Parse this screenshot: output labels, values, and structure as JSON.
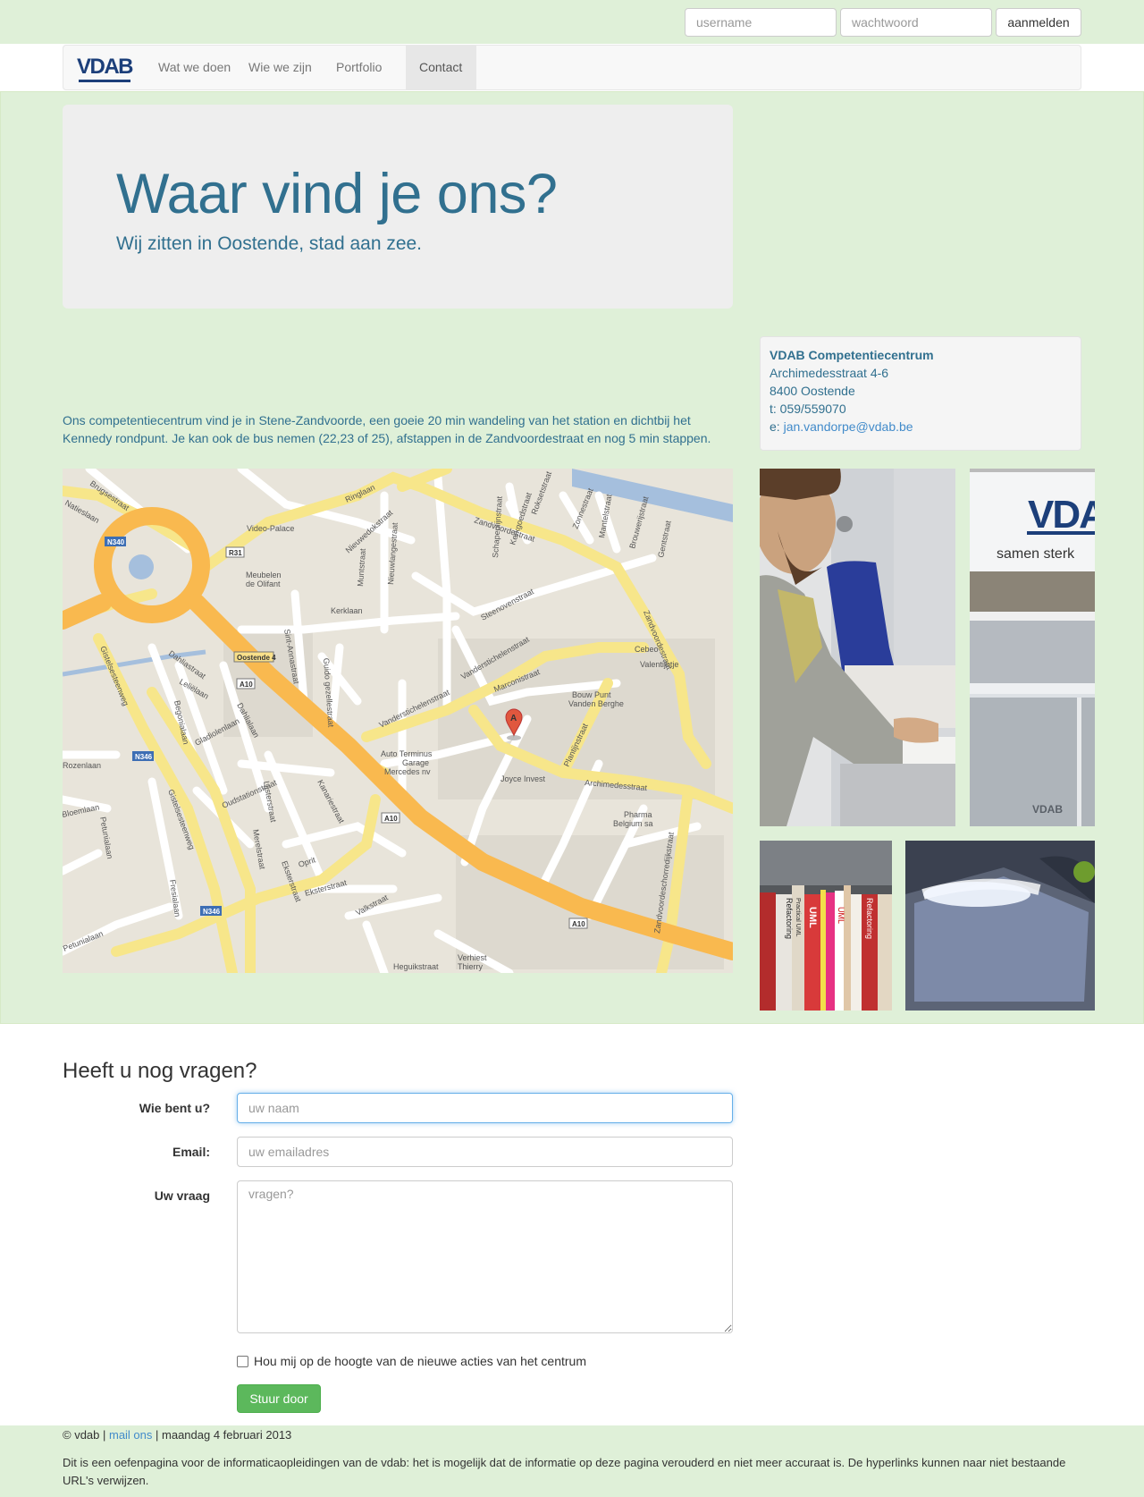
{
  "login": {
    "username_placeholder": "username",
    "password_placeholder": "wachtwoord",
    "submit_label": "aanmelden"
  },
  "nav": {
    "brand": "VDAB",
    "items": [
      {
        "label": "Wat we doen"
      },
      {
        "label": "Wie we zijn"
      },
      {
        "label": "Portfolio"
      },
      {
        "label": "Contact",
        "active": true
      }
    ]
  },
  "hero": {
    "title": "Waar vind je ons?",
    "subtitle": "Wij zitten in Oostende, stad aan zee."
  },
  "intro": "Ons competentiecentrum vind je in Stene-Zandvoorde, een goeie 20 min wandeling van het station en dichtbij het Kennedy rondpunt. Je kan ook de bus nemen (22,23 of 25), afstappen in de Zandvoordestraat en nog 5 min stappen.",
  "address": {
    "org": "VDAB Competentiecentrum",
    "street": "Archimedesstraat 4-6",
    "city": "8400 Oostende",
    "phone": "t: 059/559070",
    "email_prefix": "e: ",
    "email": "jan.vandorpe@vdab.be"
  },
  "map": {
    "streets": [
      "Brugsestraat",
      "Ringlaan",
      "Video-Palace",
      "Zandvoordestraat",
      "Zonnestraat",
      "Mantelstraat",
      "Brouwerijstraat",
      "Gentstraat",
      "Nieuwedokstraat",
      "Schapenlijnstraat",
      "Kerkgoedstraat",
      "Roksetstraat",
      "Meubelen de Olifant",
      "Muntstraat",
      "Nieuwlangestraat",
      "Kerklaan",
      "Steenovenstraat",
      "Zandvoordestraat",
      "Oostende 4",
      "Sint-Annastraat",
      "Guido gezellestraat",
      "Vanderstichelenstraat",
      "Cebeo",
      "Valentijntje",
      "Bouw Punt Vanden Berghe",
      "Marconistraat",
      "Plantijnstraat",
      "Archimedesstraat",
      "Auto Terminus Garage Mercedes nv",
      "Joyce Invest",
      "Pharma Belgium sa",
      "Zandvoordeschorredijkstraat",
      "Natieslaan",
      "Gistelsesteenweg",
      "Dahliastraat",
      "Leliëlaan",
      "Begonialaan",
      "Gladiolenlaan",
      "Oudstationstraat",
      "Lijsterstraat",
      "Kanariestraat",
      "Merelstraat",
      "Eksterstraat",
      "Oprit",
      "Valkstraat",
      "Petunialaan",
      "Fresialaan",
      "Verhiest Thierry",
      "Heguikstraat",
      "Rozenlaan",
      "Bloemlaan"
    ],
    "shields": [
      "N340",
      "R31",
      "A10",
      "N346",
      "A10",
      "A10",
      "N346",
      "A10"
    ],
    "marker": "A"
  },
  "photos": {
    "vdab_sign_text": "VDA",
    "vdab_sign_tagline": "samen sterk",
    "monitor_text": "VDAB",
    "book_spines": [
      "Refactoring",
      "UML",
      "UML",
      "Refactoring",
      "Practical UML"
    ]
  },
  "contact_form": {
    "title": "Heeft u nog vragen?",
    "name_label": "Wie bent u?",
    "name_placeholder": "uw naam",
    "email_label": "Email:",
    "email_placeholder": "uw emailadres",
    "question_label": "Uw vraag",
    "question_placeholder": "vragen?",
    "newsletter_label": "Hou mij op de hoogte van de nieuwe acties van het centrum",
    "submit_label": "Stuur door"
  },
  "footer": {
    "copyright": "© vdab | ",
    "mail_link": "mail ons",
    "date": " | maandag 4 februari 2013",
    "disclaimer": "Dit is een oefenpagina voor de informaticaopleidingen van de vdab: het is mogelijk dat de informatie op deze pagina verouderd en niet meer accuraat is. De hyperlinks kunnen naar niet bestaande URL's verwijzen."
  },
  "colors": {
    "band": "#dff0d8",
    "heading": "#31708f",
    "link": "#428bca",
    "brand": "#1c3f7a",
    "success": "#5cb85c"
  }
}
